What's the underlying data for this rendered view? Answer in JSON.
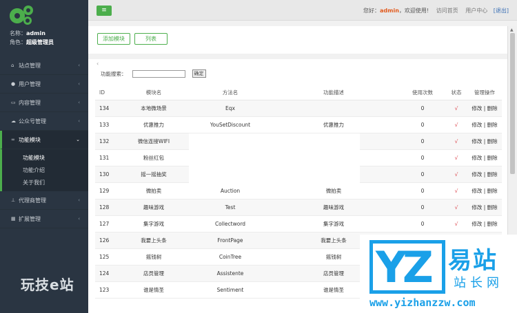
{
  "sidebar": {
    "name_label": "名称：",
    "name": "admin",
    "role_label": "角色：",
    "role": "超级管理员",
    "items": [
      {
        "label": "站点管理",
        "icon": "home-icon"
      },
      {
        "label": "用户管理",
        "icon": "user-icon"
      },
      {
        "label": "内容管理",
        "icon": "content-icon"
      },
      {
        "label": "公众号管理",
        "icon": "wechat-icon"
      },
      {
        "label": "功能模块",
        "icon": "link-icon"
      },
      {
        "label": "代理商管理",
        "icon": "sitemap-icon"
      },
      {
        "label": "扩展管理",
        "icon": "grid-icon"
      }
    ],
    "subitems": [
      "功能模块",
      "功能介绍",
      "关于我们"
    ],
    "watermark": "玩技e站"
  },
  "topbar": {
    "menu_icon": "≡",
    "greeting": "您好：",
    "user": "admin",
    "welcome": "，欢迎使用!",
    "links": [
      "访问首页",
      "用户中心"
    ],
    "logout": "[退出]"
  },
  "actions": {
    "add": "添加模块",
    "list": "列表"
  },
  "search": {
    "label": "功能搜索：",
    "value": "",
    "submit": "确定"
  },
  "table": {
    "headers": [
      "ID",
      "模块名",
      "方法名",
      "功能描述",
      "使用次数",
      "状态",
      "管理操作"
    ],
    "rows": [
      {
        "id": "134",
        "name": "本地微场景",
        "method": "Eqx",
        "desc": "",
        "uses": "0",
        "status": "√",
        "ops": "修改 | 删除"
      },
      {
        "id": "133",
        "name": "优惠推力",
        "method": "YouSetDiscount",
        "desc": "优惠推力",
        "uses": "0",
        "status": "√",
        "ops": "修改 | 删除"
      },
      {
        "id": "132",
        "name": "微信连接WIFI",
        "method": "",
        "desc": "",
        "uses": "0",
        "status": "√",
        "ops": "修改 | 删除"
      },
      {
        "id": "131",
        "name": "粉丝红包",
        "method": "",
        "desc": "",
        "uses": "0",
        "status": "√",
        "ops": "修改 | 删除"
      },
      {
        "id": "130",
        "name": "摇一摇抽奖",
        "method": "",
        "desc": "",
        "uses": "0",
        "status": "√",
        "ops": "修改 | 删除"
      },
      {
        "id": "129",
        "name": "微拍卖",
        "method": "Auction",
        "desc": "微拍卖",
        "uses": "0",
        "status": "√",
        "ops": "修改 | 删除"
      },
      {
        "id": "128",
        "name": "趣味游戏",
        "method": "Test",
        "desc": "趣味游戏",
        "uses": "0",
        "status": "√",
        "ops": "修改 | 删除"
      },
      {
        "id": "127",
        "name": "集字游戏",
        "method": "Collectword",
        "desc": "集字游戏",
        "uses": "0",
        "status": "√",
        "ops": "修改 | 删除"
      },
      {
        "id": "126",
        "name": "我要上头条",
        "method": "FrontPage",
        "desc": "我要上头条",
        "uses": "",
        "status": "",
        "ops": ""
      },
      {
        "id": "125",
        "name": "摇钱树",
        "method": "CoinTree",
        "desc": "摇钱树",
        "uses": "",
        "status": "",
        "ops": ""
      },
      {
        "id": "124",
        "name": "店员管理",
        "method": "Assistente",
        "desc": "店员管理",
        "uses": "",
        "status": "",
        "ops": ""
      },
      {
        "id": "123",
        "name": "谁是情圣",
        "method": "Sentiment",
        "desc": "谁是情圣",
        "uses": "",
        "status": "",
        "ops": ""
      }
    ]
  },
  "watermark_logo": {
    "letters": "YZ",
    "cn_big": "易站",
    "cn_small": "站长网",
    "url": "www.yizhanzzw.com"
  },
  "colors": {
    "sidebar_bg": "#2a3542",
    "accent_green": "#4cae4c",
    "admin_orange": "#e25a1c",
    "status_red": "#d9363e",
    "watermark_blue": "#1aa0e8"
  }
}
